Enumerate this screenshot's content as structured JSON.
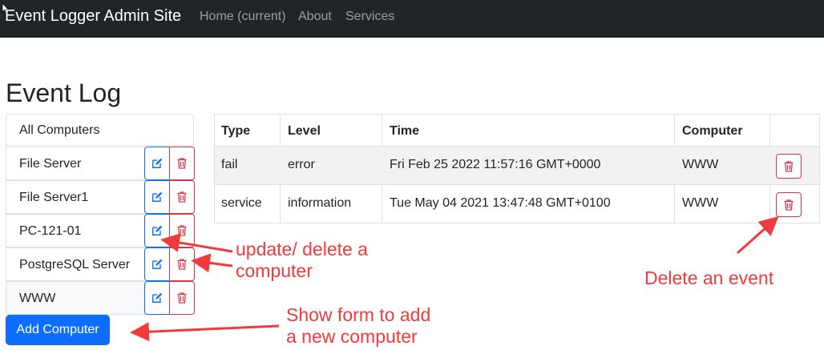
{
  "navbar": {
    "brand": "Event Logger Admin Site",
    "links": [
      "Home (current)",
      "About",
      "Services"
    ]
  },
  "page_title": "Event Log",
  "computers": {
    "all_label": "All Computers",
    "items": [
      "File Server",
      "File Server1",
      "PC-121-01",
      "PostgreSQL Server",
      "WWW"
    ],
    "add_button": "Add Computer"
  },
  "events": {
    "headers": [
      "Type",
      "Level",
      "Time",
      "Computer"
    ],
    "rows": [
      {
        "type": "fail",
        "level": "error",
        "time": "Fri Feb 25 2022 11:57:16 GMT+0000",
        "computer": "WWW"
      },
      {
        "type": "service",
        "level": "information",
        "time": "Tue May 04 2021 13:47:48 GMT+0100",
        "computer": "WWW"
      }
    ]
  },
  "annotations": {
    "update_delete": [
      "update/ delete a",
      "computer"
    ],
    "delete_event": "Delete an event",
    "show_form": [
      "Show form to add",
      "a new computer"
    ]
  },
  "icons": {
    "edit": "pencil-square-icon",
    "delete": "trash-icon"
  },
  "colors": {
    "navbar_bg": "#212529",
    "primary": "#0d6efd",
    "danger": "#dc3545",
    "annotation": "#ef3b3b"
  }
}
